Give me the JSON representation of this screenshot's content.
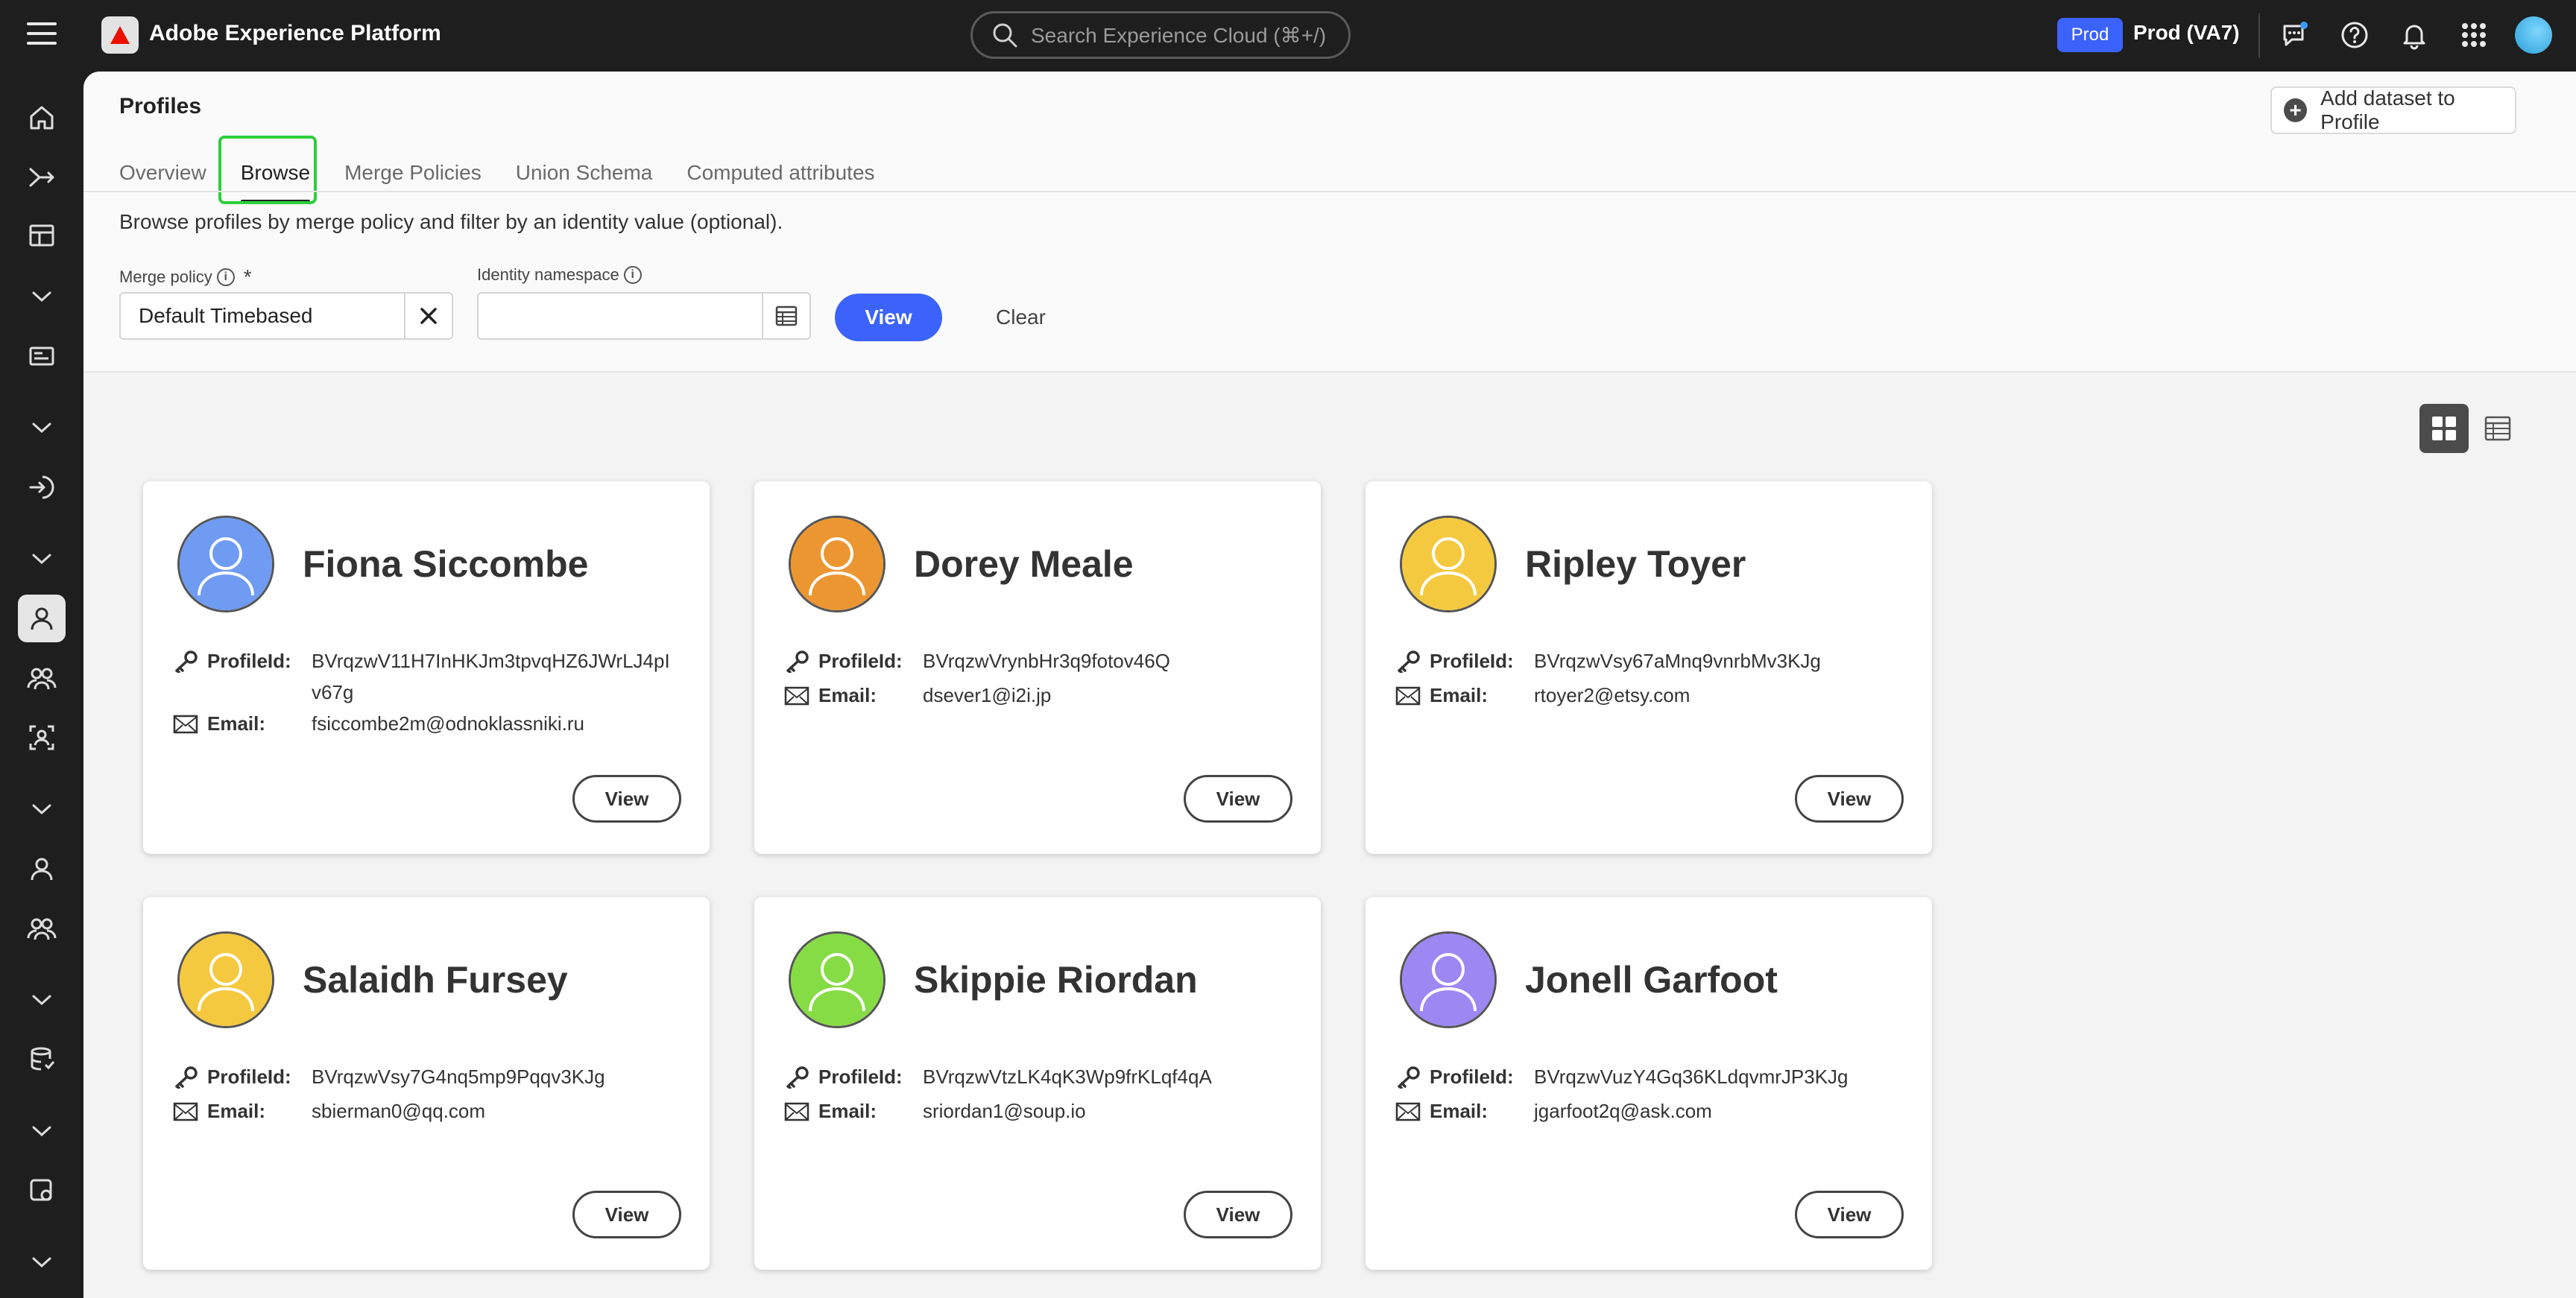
{
  "app": {
    "title": "Adobe Experience Platform",
    "search_placeholder": "Search Experience Cloud (⌘+/)",
    "env_badge": "Prod",
    "env_name": "Prod (VA7)",
    "brand_color": "#eb1000",
    "accent_color": "#3b63fb"
  },
  "page": {
    "title": "Profiles",
    "add_dataset_label": "Add dataset to Profile",
    "tabs": [
      {
        "label": "Overview"
      },
      {
        "label": "Browse",
        "selected": true
      },
      {
        "label": "Merge Policies"
      },
      {
        "label": "Union Schema"
      },
      {
        "label": "Computed attributes"
      }
    ],
    "description": "Browse profiles by merge policy and filter by an identity value (optional).",
    "merge_policy_label": "Merge policy",
    "merge_policy_value": "Default Timebased",
    "identity_namespace_label": "Identity namespace",
    "identity_namespace_value": "",
    "view_label": "View",
    "clear_label": "Clear"
  },
  "profiles": [
    {
      "name": "Fiona Siccombe",
      "profile_id": "BVrqzwV11H7InHKJm3tpvqHZ6JWrLJ4pIv67g",
      "email": "fsiccombe2m@odnoklassniki.ru",
      "avatar_color": "#6f9bf3"
    },
    {
      "name": "Dorey Meale",
      "profile_id": "BVrqzwVrynbHr3q9fotov46Q",
      "email": "dsever1@i2i.jp",
      "avatar_color": "#ec9631"
    },
    {
      "name": "Ripley Toyer",
      "profile_id": "BVrqzwVsy67aMnq9vnrbMv3KJg",
      "email": "rtoyer2@etsy.com",
      "avatar_color": "#f5c93f"
    },
    {
      "name": "Salaidh Fursey",
      "profile_id": "BVrqzwVsy7G4nq5mp9Pqqv3KJg",
      "email": "sbierman0@qq.com",
      "avatar_color": "#f5c93f"
    },
    {
      "name": "Skippie Riordan",
      "profile_id": "BVrqzwVtzLK4qK3Wp9frKLqf4qA",
      "email": "sriordan1@soup.io",
      "avatar_color": "#86dc45"
    },
    {
      "name": "Jonell Garfoot",
      "profile_id": "BVrqzwVuzY4Gq36KLdqvmrJP3KJg",
      "email": "jgarfoot2q@ask.com",
      "avatar_color": "#9c87f3"
    }
  ],
  "card_labels": {
    "profile_id": "ProfileId:",
    "email": "Email:",
    "view": "View"
  }
}
